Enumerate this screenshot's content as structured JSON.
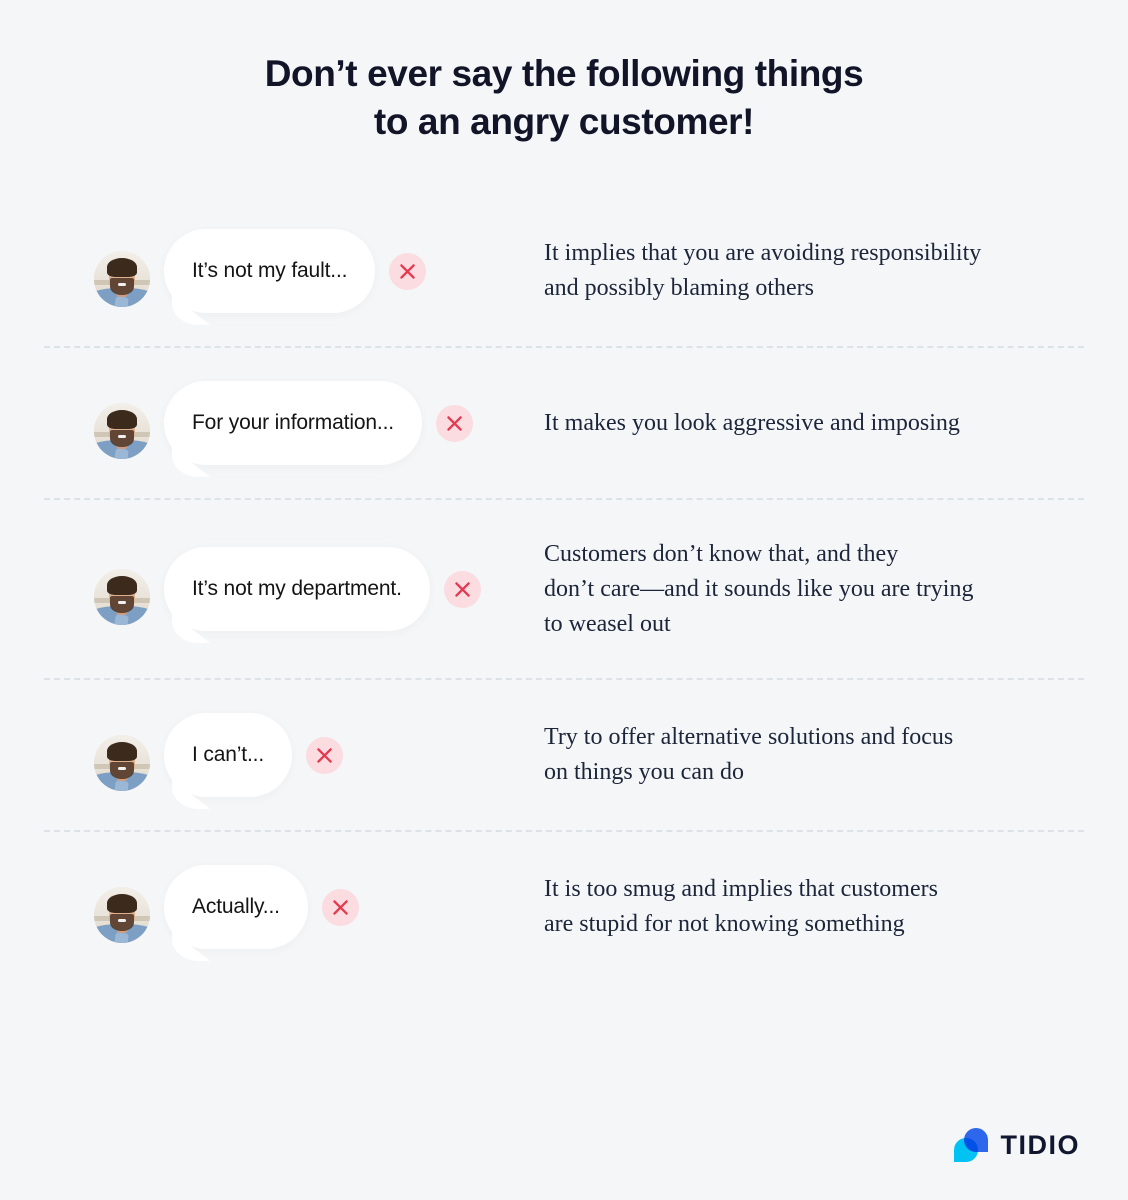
{
  "page": {
    "background_color": "#f4f6f8",
    "title_line_1": "Don’t ever say the following things",
    "title_line_2": "to an angry customer!",
    "title_color": "#111527"
  },
  "colors": {
    "badge_circle": "#fbdce1",
    "badge_x": "#e63950",
    "bubble": "#ffffff",
    "divider": "#dde2e9",
    "description_text": "#1c2539",
    "logo_cyan": "#00c2f3",
    "logo_blue": "#2f6bf2"
  },
  "rows": [
    {
      "phrase": "It’s not my fault...",
      "badge_icon": "close-x-icon",
      "avatar_icon": "customer-avatar",
      "description_lines": [
        "It implies that you are avoiding responsibility",
        "and possibly blaming others"
      ]
    },
    {
      "phrase": "For your information...",
      "badge_icon": "close-x-icon",
      "avatar_icon": "customer-avatar",
      "description_lines": [
        "It makes you look aggressive and imposing"
      ]
    },
    {
      "phrase": "It’s not my department.",
      "badge_icon": "close-x-icon",
      "avatar_icon": "customer-avatar",
      "description_lines": [
        "Customers don’t know that, and they",
        "don’t care—and it sounds like you are trying",
        "to weasel out"
      ]
    },
    {
      "phrase": "I can’t...",
      "badge_icon": "close-x-icon",
      "avatar_icon": "customer-avatar",
      "description_lines": [
        "Try to offer alternative solutions and focus",
        "on things you can do"
      ]
    },
    {
      "phrase": "Actually...",
      "badge_icon": "close-x-icon",
      "avatar_icon": "customer-avatar",
      "description_lines": [
        "It is too smug and implies that customers",
        "are stupid for not knowing something"
      ]
    }
  ],
  "logo": {
    "wordmark": "TIDIO",
    "mark_icon": "tidio-chat-logo-icon"
  }
}
